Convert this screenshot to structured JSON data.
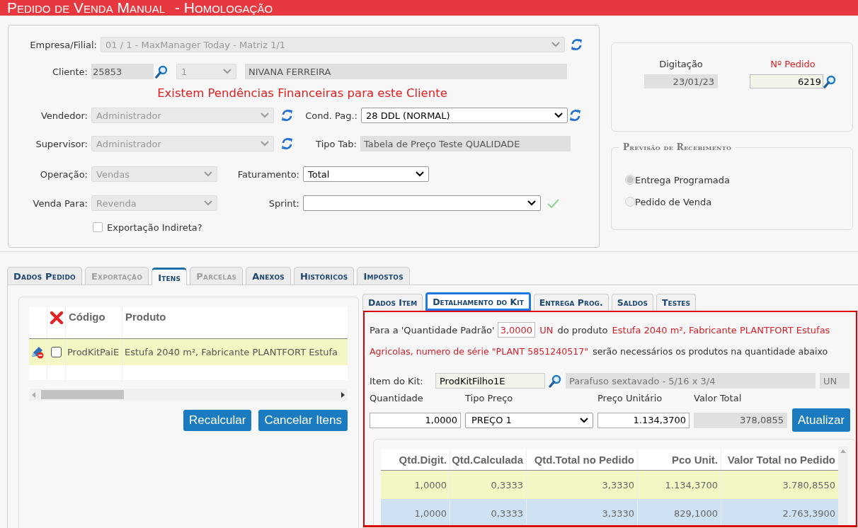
{
  "header": {
    "title": "Pedido de Venda Manual",
    "environment": "- Homologação"
  },
  "form": {
    "company": {
      "label": "Empresa/Filial:",
      "value": "01 / 1 - MaxManager Today - Matriz 1/1",
      "disabled": true
    },
    "client": {
      "label": "Cliente:",
      "code": "25853",
      "branch": "1",
      "name": "NIVANA FERREIRA"
    },
    "warning": "Existem Pendências Financeiras para este Cliente",
    "seller": {
      "label": "Vendedor:",
      "value": "Administrador",
      "disabled": true
    },
    "payment_terms": {
      "label": "Cond. Pag.:",
      "value": "28 DDL (NORMAL)",
      "disabled": false
    },
    "supervisor": {
      "label": "Supervisor:",
      "value": "Administrador",
      "disabled": true
    },
    "price_table": {
      "label": "Tipo Tab:",
      "value": "Tabela de Preço Teste QUALIDADE"
    },
    "operation": {
      "label": "Operação:",
      "value": "Vendas",
      "disabled": true
    },
    "billing": {
      "label": "Faturamento:",
      "value": "Total",
      "disabled": false
    },
    "sale_to": {
      "label": "Venda Para:",
      "value": "Revenda",
      "disabled": true
    },
    "sprint": {
      "label": "Sprint:",
      "disabled": false
    },
    "indirect_export": {
      "label": "Exportação Indireta?",
      "checked": false
    }
  },
  "order": {
    "typed_label": "Digitação",
    "typed_value": "23/01/23",
    "number_label": "Nº Pedido",
    "number_value": "6219"
  },
  "receipt_forecast": {
    "title": "Previsão de Recebimento",
    "options": [
      {
        "label": "Entrega Programada",
        "selected": true
      },
      {
        "label": "Pedido de Venda",
        "selected": false
      }
    ]
  },
  "tabs": [
    {
      "label": "Dados Pedido",
      "selected": false,
      "disabled": false
    },
    {
      "label": "Exportação",
      "selected": false,
      "disabled": true
    },
    {
      "label": "Itens",
      "selected": true,
      "disabled": false
    },
    {
      "label": "Parcelas",
      "selected": false,
      "disabled": true
    },
    {
      "label": "Anexos",
      "selected": false,
      "disabled": false
    },
    {
      "label": "Históricos",
      "selected": false,
      "disabled": false
    },
    {
      "label": "Impostos",
      "selected": false,
      "disabled": false
    }
  ],
  "items_grid": {
    "columns": [
      "Código",
      "Produto"
    ],
    "rows": [
      {
        "code": "ProdKitPaiE",
        "product": "Estufa 2040 m², Fabricante PLANTFORT Estufa",
        "checked": false,
        "selected": false
      }
    ],
    "buttons": [
      "Recalcular",
      "Cancelar Itens"
    ]
  },
  "item_tabs": [
    {
      "label": "Dados Item",
      "selected": false
    },
    {
      "label": "Detalhamento do Kit",
      "selected": true
    },
    {
      "label": "Entrega Prog.",
      "selected": false
    },
    {
      "label": "Saldos",
      "selected": false
    },
    {
      "label": "Testes",
      "selected": false
    }
  ],
  "kit": {
    "intro": "Para a 'Quantidade Padrão'",
    "standard_quantity": "3,0000",
    "unit": "UN",
    "product_prefix": "do produto",
    "product_name_line_1": "Estufa 2040 m², Fabricante PLANTFORT Estufas",
    "product_name_line_2": "Agricolas, numero de série \"PLANT 5851240517\"",
    "outro": "serão necessários os produtos na quantidade abaixo",
    "item": {
      "label": "Item do Kit:",
      "code": "ProdKitFilho1E",
      "description": "Parafuso sextavado - 5/16 x 3/4",
      "unit": "UN"
    },
    "fields": [
      {
        "label": "Quantidade",
        "value": "1,0000",
        "kind": "input"
      },
      {
        "label": "Tipo Preço",
        "value": "PREÇO 1",
        "kind": "select"
      },
      {
        "label": "Preço Unitário",
        "value": "1.134,3700",
        "kind": "input"
      },
      {
        "label": "Valor Total",
        "value": "378,0855",
        "kind": "readonly"
      }
    ],
    "update_button": "Atualizar",
    "table": {
      "columns": [
        "Qtd.Digit.",
        "Qtd.Calculada",
        "Qtd.Total no Pedido",
        "Pco Unit.",
        "Valor Total no Pedido"
      ],
      "rows": [
        {
          "cells": [
            "1,0000",
            "0,3333",
            "3,3330",
            "1.134,3700",
            "3.780,8550"
          ],
          "selected": false
        },
        {
          "cells": [
            "1,0000",
            "0,3333",
            "3,3330",
            "829,1000",
            "2.763,3900"
          ],
          "selected": true
        }
      ]
    }
  }
}
